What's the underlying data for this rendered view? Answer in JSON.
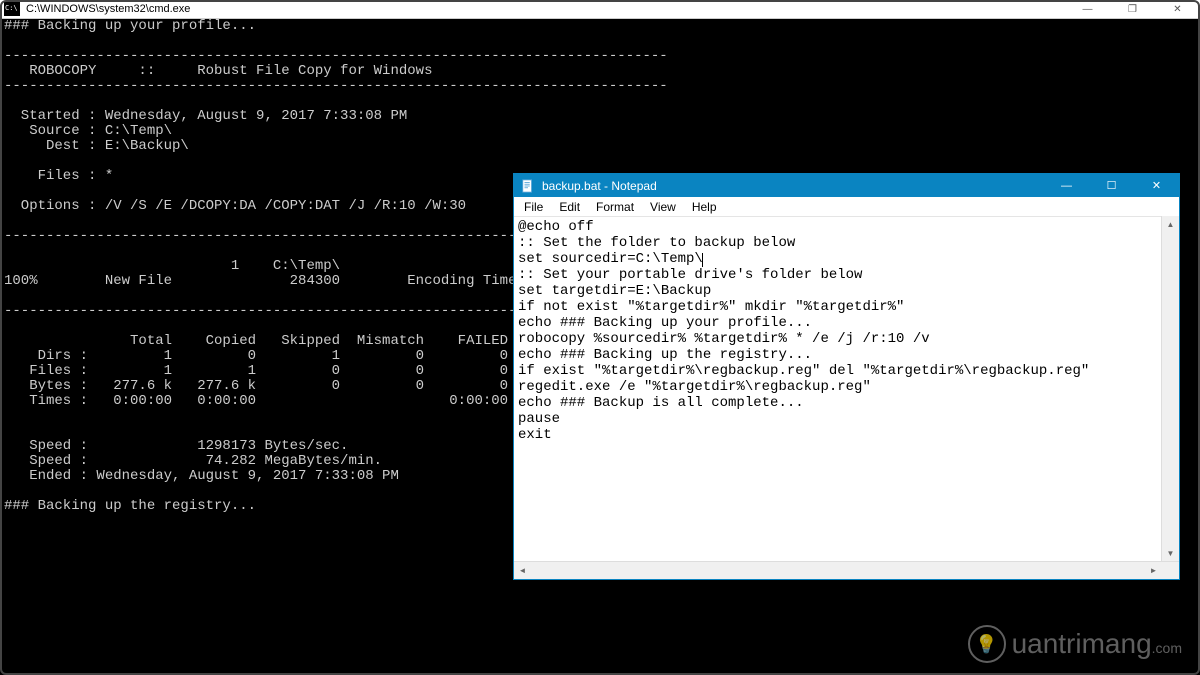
{
  "cmd": {
    "title": "C:\\WINDOWS\\system32\\cmd.exe",
    "buttons": {
      "min": "—",
      "max": "❐",
      "close": "✕"
    },
    "output": "### Backing up your profile...\n\n-------------------------------------------------------------------------------\n   ROBOCOPY     ::     Robust File Copy for Windows\n-------------------------------------------------------------------------------\n\n  Started : Wednesday, August 9, 2017 7:33:08 PM\n   Source : C:\\Temp\\\n     Dest : E:\\Backup\\\n\n    Files : *\n\n  Options : /V /S /E /DCOPY:DA /COPY:DAT /J /R:10 /W:30\n\n------------------------------------------------------------------------------\n\n                           1    C:\\Temp\\\n100%        New File              284300        Encoding Time.csv\n\n------------------------------------------------------------------------------\n\n               Total    Copied   Skipped  Mismatch    FAILED    Extras\n    Dirs :         1         0         1         0         0         0\n   Files :         1         1         0         0         0         0\n   Bytes :   277.6 k   277.6 k         0         0         0         0\n   Times :   0:00:00   0:00:00                       0:00:00   0:00:00\n\n\n   Speed :             1298173 Bytes/sec.\n   Speed :              74.282 MegaBytes/min.\n   Ended : Wednesday, August 9, 2017 7:33:08 PM\n\n### Backing up the registry...\n"
  },
  "notepad": {
    "title": "backup.bat - Notepad",
    "menu": {
      "file": "File",
      "edit": "Edit",
      "format": "Format",
      "view": "View",
      "help": "Help"
    },
    "buttons": {
      "min": "—",
      "max": "☐",
      "close": "✕"
    },
    "content_before_caret": "@echo off\n:: Set the folder to backup below\nset sourcedir=C:\\Temp\\",
    "content_after_caret": "\n:: Set your portable drive's folder below\nset targetdir=E:\\Backup\nif not exist \"%targetdir%\" mkdir \"%targetdir%\"\necho ### Backing up your profile...\nrobocopy %sourcedir% %targetdir% * /e /j /r:10 /v\necho ### Backing up the registry...\nif exist \"%targetdir%\\regbackup.reg\" del \"%targetdir%\\regbackup.reg\"\nregedit.exe /e \"%targetdir%\\regbackup.reg\"\necho ### Backup is all complete...\npause\nexit"
  },
  "watermark": {
    "text": "uantrimang",
    "host": ".com"
  }
}
